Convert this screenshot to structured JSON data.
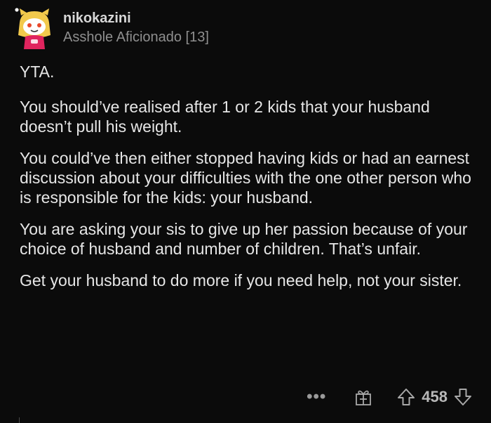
{
  "comment": {
    "username": "nikokazini",
    "flair": "Asshole Aficionado [13]",
    "paragraphs": [
      "YTA.",
      "You should’ve realised after 1 or 2 kids that your husband doesn’t pull his weight.",
      "You could’ve then either stopped having kids or had an earnest discussion about your difficulties with the one other person who is responsible for the kids: your husband.",
      "You are asking your sis to give up her passion because of your choice of husband and number of children. That’s unfair.",
      "Get your husband to do more if you need help, not your sister."
    ],
    "actions": {
      "more_label": "•••",
      "score": "458"
    }
  },
  "icons": {
    "avatar": "avatar-snoo-icon",
    "award": "gift-award-icon",
    "upvote": "upvote-arrow-icon",
    "downvote": "downvote-arrow-icon"
  },
  "colors": {
    "background": "#0b0b0b",
    "text": "#e6e6e6",
    "muted": "#8f8f8f",
    "avatar_yellow": "#f2c94c",
    "avatar_pink": "#e0245e"
  }
}
